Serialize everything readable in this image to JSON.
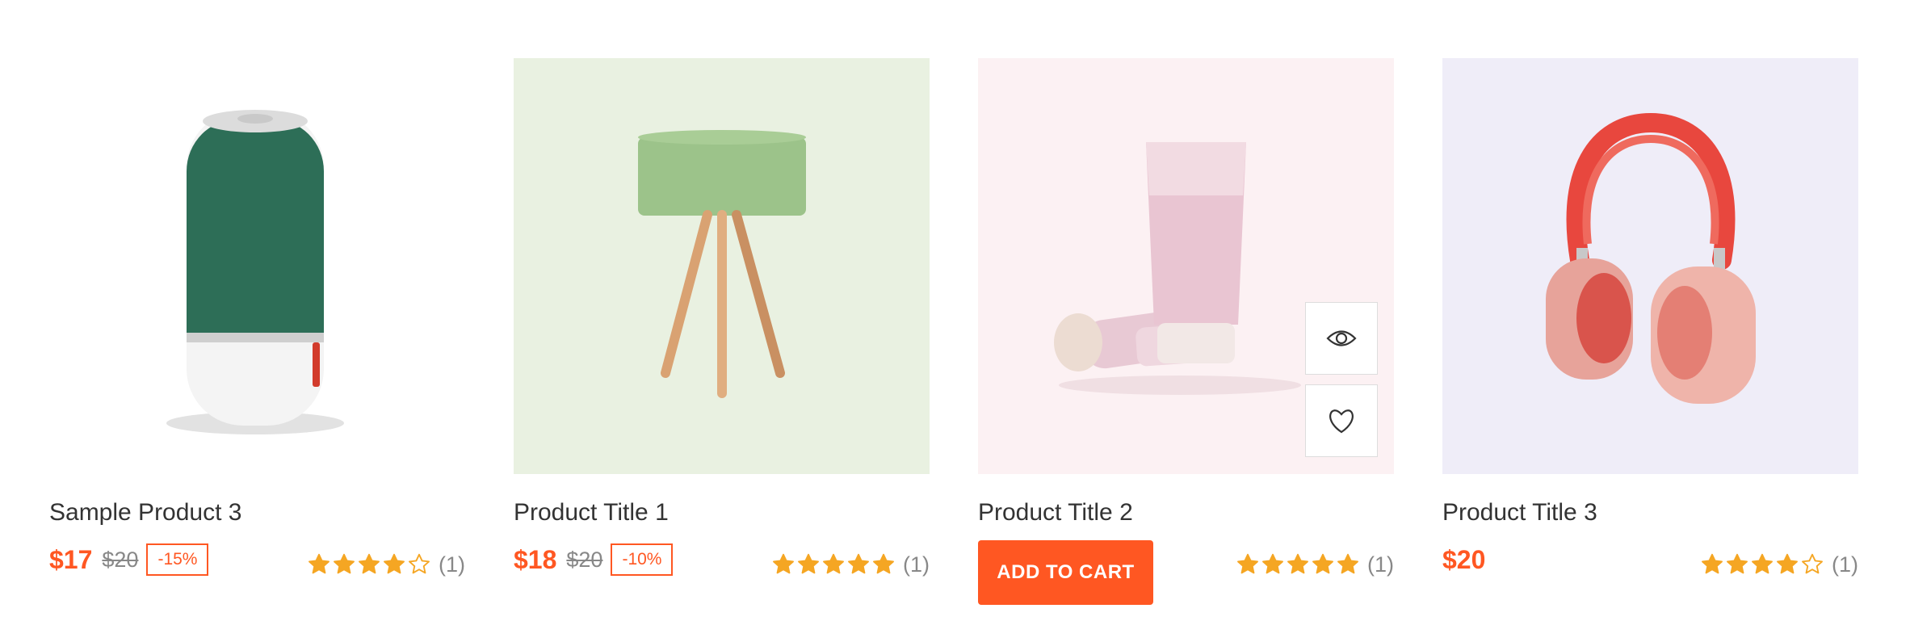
{
  "products": [
    {
      "title": "Sample Product 3",
      "price": "$17",
      "old_price": "$20",
      "discount": "-15%",
      "rating": 4,
      "count": "(1)",
      "bg": "#ffffff"
    },
    {
      "title": "Product Title 1",
      "price": "$18",
      "old_price": "$20",
      "discount": "-10%",
      "rating": 5,
      "count": "(1)",
      "bg": "#e9f1e1"
    },
    {
      "title": "Product Title 2",
      "rating": 5,
      "count": "(1)",
      "cart_label": "ADD TO CART",
      "bg": "#fcf1f3"
    },
    {
      "title": "Product Title 3",
      "price": "$20",
      "rating": 4,
      "count": "(1)",
      "bg": "#efedf8"
    }
  ],
  "colors": {
    "accent": "#ff5722",
    "star": "#f5a623"
  },
  "icons": {
    "quick_view": "eye-icon",
    "wishlist": "heart-icon",
    "rating_star": "star-icon"
  }
}
